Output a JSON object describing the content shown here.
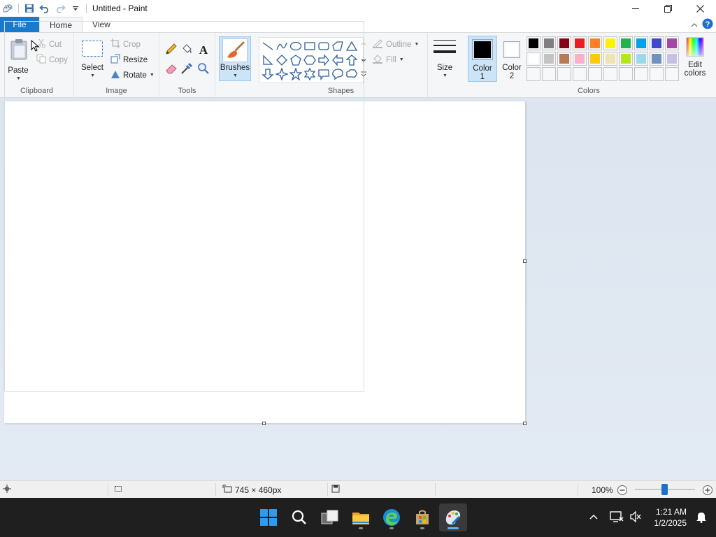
{
  "window": {
    "title": "Untitled - Paint"
  },
  "tabs": {
    "file": "File",
    "home": "Home",
    "view": "View"
  },
  "clipboard": {
    "paste": "Paste",
    "cut": "Cut",
    "copy": "Copy",
    "group": "Clipboard"
  },
  "image": {
    "select": "Select",
    "crop": "Crop",
    "resize": "Resize",
    "rotate": "Rotate",
    "group": "Image"
  },
  "tools": {
    "group": "Tools"
  },
  "brushes": {
    "label": "Brushes"
  },
  "shapes": {
    "group": "Shapes",
    "outline": "Outline",
    "fill": "Fill"
  },
  "size": {
    "label": "Size"
  },
  "colors": {
    "color1_a": "Color",
    "color1_b": "1",
    "color2_a": "Color",
    "color2_b": "2",
    "group": "Colors",
    "edit_a": "Edit",
    "edit_b": "colors",
    "color1_value": "#000000",
    "color2_value": "#ffffff",
    "palette_row1": [
      "#000000",
      "#7f7f7f",
      "#880015",
      "#ed1c24",
      "#ff7f27",
      "#fff200",
      "#22b14c",
      "#00a2e8",
      "#3f48cc",
      "#a349a4"
    ],
    "palette_row2": [
      "#ffffff",
      "#c3c3c3",
      "#b97a57",
      "#ffaec9",
      "#ffc90e",
      "#efe4b0",
      "#b5e61d",
      "#99d9ea",
      "#7092be",
      "#c8bfe7"
    ],
    "palette_row3": [
      "#ffffff",
      "#ffffff",
      "#ffffff",
      "#ffffff",
      "#ffffff",
      "#ffffff",
      "#ffffff",
      "#ffffff",
      "#ffffff",
      "#ffffff"
    ]
  },
  "status": {
    "canvas_size": "745 × 460px",
    "zoom": "100%"
  },
  "taskbar": {
    "time": "1:21 AM",
    "date": "1/2/2025"
  }
}
